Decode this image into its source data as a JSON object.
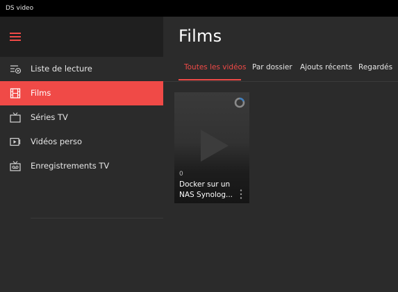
{
  "window": {
    "title": "DS video"
  },
  "sidebar": {
    "items": [
      {
        "label": "Liste de lecture",
        "icon": "playlist-icon"
      },
      {
        "label": "Films",
        "icon": "film-icon",
        "active": true
      },
      {
        "label": "Séries TV",
        "icon": "tv-icon"
      },
      {
        "label": "Vidéos perso",
        "icon": "video-icon"
      },
      {
        "label": "Enregistrements TV",
        "icon": "tv-recording-icon"
      }
    ]
  },
  "main": {
    "title": "Films",
    "tabs": [
      {
        "label": "Toutes les vidéos",
        "active": true
      },
      {
        "label": "Par dossier"
      },
      {
        "label": "Ajouts récents"
      },
      {
        "label": "Regardés"
      }
    ],
    "videos": [
      {
        "count": "0",
        "title": "Docker sur un NAS Synolog..."
      }
    ]
  },
  "colors": {
    "accent": "#f04a47",
    "sidebar_bg": "#1f1f1f",
    "content_bg": "#2b2b2b",
    "titlebar_bg": "#000000"
  }
}
